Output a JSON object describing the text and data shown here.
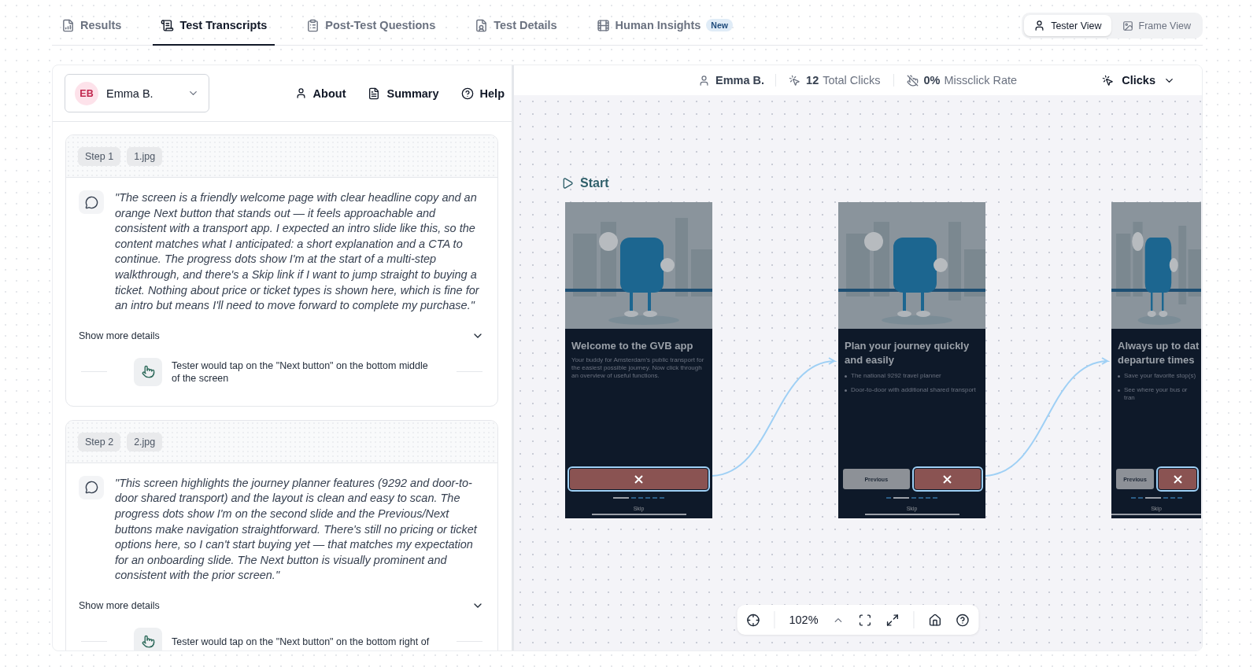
{
  "tabs": [
    {
      "label": "Results",
      "selected": false
    },
    {
      "label": "Test Transcripts",
      "selected": true
    },
    {
      "label": "Post-Test Questions",
      "selected": false
    },
    {
      "label": "Test Details",
      "selected": false
    },
    {
      "label": "Human Insights",
      "badge": "New",
      "selected": false
    }
  ],
  "view_toggle": [
    {
      "label": "Tester View",
      "selected": true
    },
    {
      "label": "Frame View",
      "selected": false
    }
  ],
  "tester": {
    "initials": "EB",
    "name": "Emma B."
  },
  "panel_links": [
    {
      "label": "About"
    },
    {
      "label": "Summary"
    },
    {
      "label": "Help"
    }
  ],
  "steps": [
    {
      "step": "Step 1",
      "file": "1.jpg",
      "quote": "\"The screen is a friendly welcome page with clear headline copy and an orange Next button that stands out — it feels approachable and consistent with a transport app. I expected an intro slide like this, so the content matches what I anticipated: a short explanation and a CTA to continue. The progress dots show I'm at the start of a multi-step walkthrough, and there's a Skip link if I want to jump straight to buying a ticket. Nothing about price or ticket types is shown here, which is fine for an intro but means I'll need to move forward to complete my purchase.\"",
      "more": "Show more details",
      "action": "Tester would tap on the \"Next button\" on the bottom middle of the screen"
    },
    {
      "step": "Step 2",
      "file": "2.jpg",
      "quote": "\"This screen highlights the journey planner features (9292 and door-to-door shared transport) and the layout is clean and easy to scan. The progress dots show I'm on the second slide and the Previous/Next buttons make navigation straightforward. There's still no pricing or ticket options here, so I can't start buying yet — that matches my expectation for an onboarding slide. The Next button is visually prominent and consistent with the prior screen.\"",
      "more": "Show more details",
      "action": "Tester would tap on the \"Next button\" on the bottom right of"
    }
  ],
  "canvas_header": {
    "tester": "Emma B.",
    "clicks_value": "12",
    "clicks_label": "Total Clicks",
    "miss_value": "0%",
    "miss_label": "Missclick Rate",
    "mode": "Clicks"
  },
  "start_label": "Start",
  "frames": [
    {
      "title_lines": [
        "Welcome to the GVB app"
      ],
      "body": "Your buddy for Amsterdam's public transport for the easiest possible journey. Now click through an overview of useful functions.",
      "buttons": [
        {
          "kind": "primary",
          "clicked": true
        }
      ],
      "dots": [
        {
          "selected": true
        },
        {
          "selected": false
        },
        {
          "selected": false
        },
        {
          "selected": false
        },
        {
          "selected": false
        },
        {
          "selected": false
        }
      ],
      "skip": "Skip"
    },
    {
      "title_lines": [
        "Plan your journey quickly",
        "and easily"
      ],
      "bullets": [
        "The national 9292 travel planner",
        "Door-to-door with additional shared transport"
      ],
      "buttons": [
        {
          "kind": "secondary",
          "label": "Previous",
          "clicked": false
        },
        {
          "kind": "primary",
          "clicked": true
        }
      ],
      "dots": [
        {
          "selected": false
        },
        {
          "selected": true
        },
        {
          "selected": false
        },
        {
          "selected": false
        },
        {
          "selected": false
        },
        {
          "selected": false
        }
      ],
      "skip": "Skip"
    },
    {
      "title_lines": [
        "Always up to dat",
        "departure times"
      ],
      "bullets": [
        "Save your favorite stop(s)",
        "See where your bus or tran"
      ],
      "buttons": [
        {
          "kind": "secondary",
          "label": "Previous",
          "clicked": false
        },
        {
          "kind": "primary",
          "clicked": true
        }
      ],
      "dots": [
        {
          "selected": false
        },
        {
          "selected": false
        },
        {
          "selected": true
        },
        {
          "selected": false
        },
        {
          "selected": false
        },
        {
          "selected": false
        }
      ],
      "skip": "Skip"
    }
  ],
  "zoom": "102%"
}
